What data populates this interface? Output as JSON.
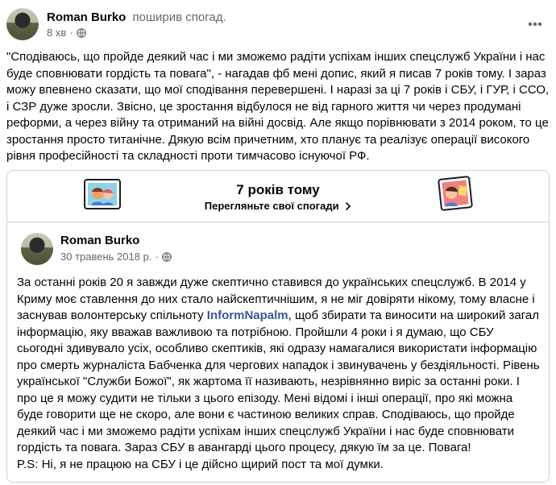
{
  "post": {
    "author": "Roman Burko",
    "action": "поширив спогад.",
    "time": "8 хв",
    "dot": "·",
    "text": "\"Сподіваюсь, що пройде деякий час і ми зможемо радіти успіхам інших спецслужб України і нас буде сповнювати гордість та повага\", -  нагадав фб мені допис, який я писав 7 років тому. І зараз можу впевнено сказати, що мої сподівання перевершені. І наразі за ці 7 років і СБУ, і ГУР, і ССО, і СЗР дуже зросли. Звісно, це зростання відбулося не від гарного життя чи  через продумані реформи, а через війну та отриманий на війні досвід. Але якщо порівнювати з 2014 роком, то це зростання просто титанічне.  Дякую всім причетним, хто планує та реалізує операції високого рівня професійності та складності проти тимчасово існуючої РФ."
  },
  "memory": {
    "title": "7 років тому",
    "link": "Перегляньте свої спогади"
  },
  "original": {
    "author": "Roman Burko",
    "date": "30 травень 2018 р.",
    "dot": "·",
    "text_before_tag": "За останні років 20 я завжди дуже скептично ставився до українських спецслужб. В 2014 у Криму моє ставлення до них стало найскептичнішим, я не міг довіряти нікому, тому власне і заснував волонтерську спільноту ",
    "tag": "InformNapalm",
    "text_after_tag": ", щоб збирати та виносити на широкий загал інформацію, яку вважав важливою та потрібною. Пройшли 4 роки і я думаю, що СБУ сьогодні здивувало усіх, особливо скептиків, які одразу намагалися використати інформацію про смерть журналіста Бабченка для чергових нападок і звинувачень у бездіяльності. Рівень української \"Служби Божої\", як жартома її називають, незрівнянно виріс за останні роки. І про це я можу судити не тільки з цього епізоду. Мені відомі і інші операції, про які можна буде говорити ще не скоро, але вони є частиною великих справ. Сподіваюсь, що пройде деякий час і ми зможемо радіти успіхам інших спецслужб України і нас буде сповнювати гордість та повага. Зараз СБУ в авангарді цього процесу, дякую їм за це. Повага!",
    "ps": "P.S: Ні, я не працюю на СБУ і це дійсно щирий пост та мої думки."
  },
  "icons": {
    "privacy": "globe-icon",
    "menu": "more-horizontal-icon",
    "link_arrow": "chevron-right-icon",
    "memory_left": "memory-sticker-left-icon",
    "memory_right": "memory-sticker-right-icon"
  },
  "colors": {
    "text": "#050505",
    "secondary": "#65676b",
    "link": "#385898",
    "border": "#ced0d4"
  }
}
